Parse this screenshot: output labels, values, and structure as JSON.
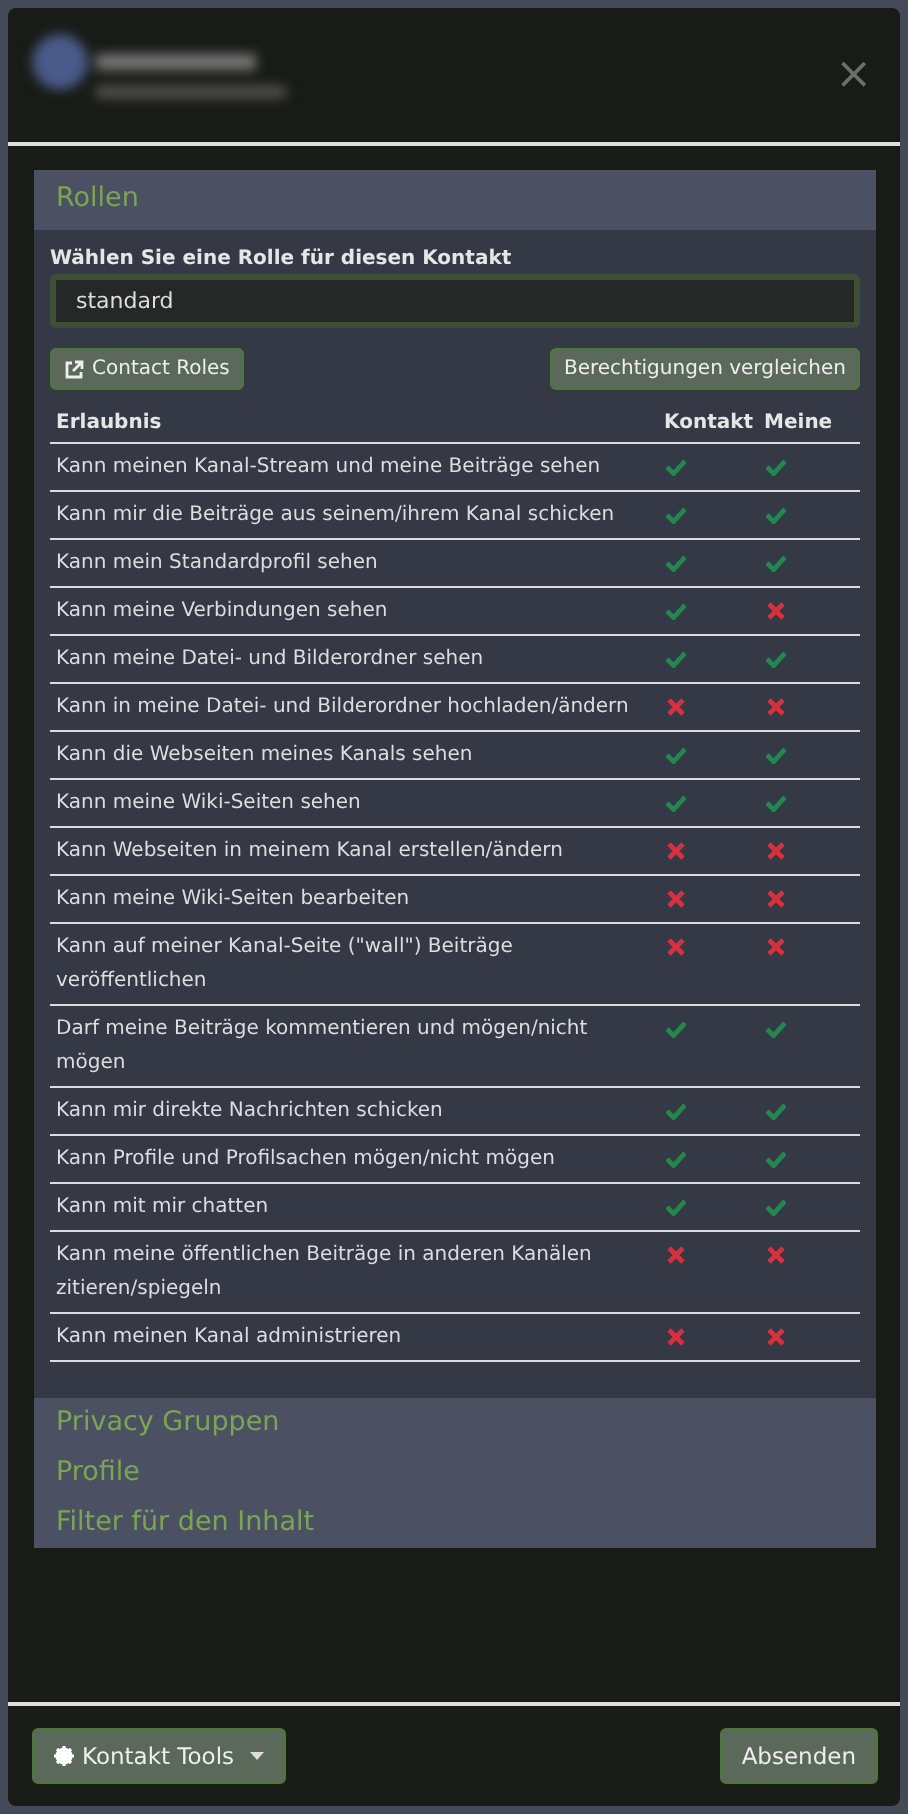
{
  "header": {
    "close": "×"
  },
  "sections": [
    {
      "title": "Rollen",
      "expanded": true
    }
  ],
  "roles": {
    "label": "Wählen Sie eine Rolle für diesen Kontakt",
    "value": "standard",
    "buttons": [
      "Contact Roles",
      "Berechtigungen vergleichen"
    ]
  },
  "table": {
    "columns": [
      "Erlaubnis",
      "Kontakt",
      "Meine"
    ],
    "rows": [
      {
        "label": "Kann meinen Kanal-Stream und meine Beiträge sehen",
        "contact": true,
        "mine": true
      },
      {
        "label": "Kann mir die Beiträge aus seinem/ihrem Kanal schicken",
        "contact": true,
        "mine": true
      },
      {
        "label": "Kann mein Standardprofil sehen",
        "contact": true,
        "mine": true
      },
      {
        "label": "Kann meine Verbindungen sehen",
        "contact": true,
        "mine": false
      },
      {
        "label": "Kann meine Datei- und Bilderordner sehen",
        "contact": true,
        "mine": true
      },
      {
        "label": "Kann in meine Datei- und Bilderordner hochladen/ändern",
        "contact": false,
        "mine": false
      },
      {
        "label": "Kann die Webseiten meines Kanals sehen",
        "contact": true,
        "mine": true
      },
      {
        "label": "Kann meine Wiki-Seiten sehen",
        "contact": true,
        "mine": true
      },
      {
        "label": "Kann Webseiten in meinem Kanal erstellen/ändern",
        "contact": false,
        "mine": false
      },
      {
        "label": "Kann meine Wiki-Seiten bearbeiten",
        "contact": false,
        "mine": false
      },
      {
        "label": "Kann auf meiner Kanal-Seite (\"wall\") Beiträge veröffentlichen",
        "contact": false,
        "mine": false
      },
      {
        "label": "Darf meine Beiträge kommentieren und mögen/nicht mögen",
        "contact": true,
        "mine": true
      },
      {
        "label": "Kann mir direkte Nachrichten schicken",
        "contact": true,
        "mine": true
      },
      {
        "label": "Kann Profile und Profilsachen mögen/nicht mögen",
        "contact": true,
        "mine": true
      },
      {
        "label": "Kann mit mir chatten",
        "contact": true,
        "mine": true
      },
      {
        "label": "Kann meine öffentlichen Beiträge in anderen Kanälen zitieren/spiegeln",
        "contact": false,
        "mine": false
      },
      {
        "label": "Kann meinen Kanal administrieren",
        "contact": false,
        "mine": false
      }
    ]
  },
  "collapsed_sections": [
    {
      "title": "Privacy Gruppen",
      "expanded": false
    },
    {
      "title": "Profile",
      "expanded": false
    },
    {
      "title": "Filter für den Inhalt",
      "expanded": false
    }
  ],
  "footer": {
    "tools": "Kontakt Tools",
    "submit": "Absenden"
  }
}
